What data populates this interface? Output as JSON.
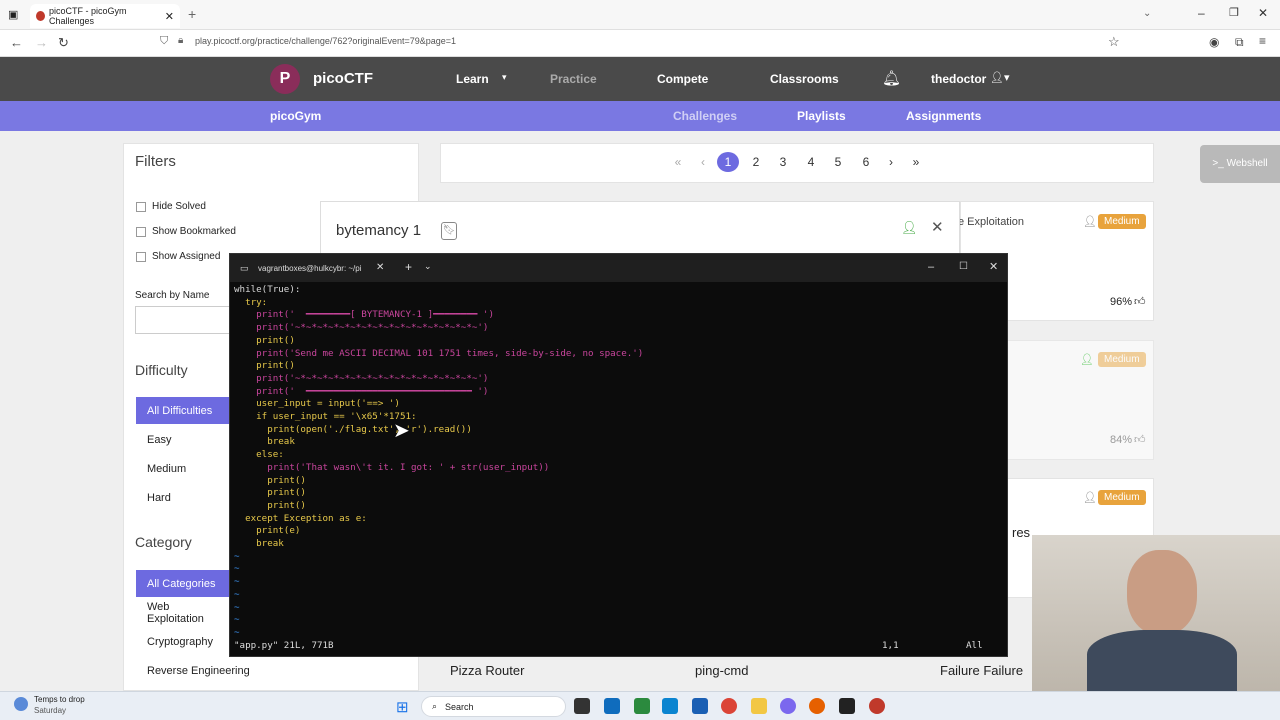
{
  "browser": {
    "tab_title": "picoCTF - picoGym Challenges",
    "url": "play.picoctf.org/practice/challenge/762?originalEvent=79&page=1"
  },
  "nav": {
    "brand": "picoCTF",
    "items": [
      "Learn",
      "Practice",
      "Compete",
      "Classrooms"
    ],
    "user": "thedoctor"
  },
  "subnav": {
    "brand": "picoGym",
    "items": [
      "Challenges",
      "Playlists",
      "Assignments"
    ]
  },
  "webshell_label": ">_ Webshell",
  "filters": {
    "title": "Filters",
    "checks": [
      "Hide Solved",
      "Show Bookmarked",
      "Show Assigned"
    ],
    "search_label": "Search by Name",
    "difficulty_title": "Difficulty",
    "difficulty": [
      "All Difficulties",
      "Easy",
      "Medium",
      "Hard"
    ],
    "category_title": "Category",
    "category": [
      "All Categories",
      "Web Exploitation",
      "Cryptography",
      "Reverse Engineering"
    ]
  },
  "pagination": {
    "first": "«",
    "prev": "‹",
    "pages": [
      "1",
      "2",
      "3",
      "4",
      "5",
      "6"
    ],
    "next": "›",
    "last": "»"
  },
  "modal": {
    "title": "bytemancy 1"
  },
  "cards": {
    "right_text": "e Exploitation",
    "badge1": "Medium",
    "pct1": "96%",
    "badge2": "Medium",
    "pct2": "84%",
    "badge3": "Medium",
    "res_text": "res",
    "bottom": [
      "Pizza Router",
      "ping-cmd",
      "Failure Failure"
    ]
  },
  "terminal": {
    "title": "vagrantboxes@hulkcybr: ~/pi",
    "code": [
      {
        "t": "while(True):",
        "c": ""
      },
      {
        "t": "  try:",
        "c": "k"
      },
      {
        "t": "    print('  ━━━━━━━━[ BYTEMANCY-1 ]━━━━━━━━ ')",
        "c": "s"
      },
      {
        "t": "    print('~*~*~*~*~*~*~*~*~*~*~*~*~*~*~*~*~')",
        "c": "s"
      },
      {
        "t": "    print()",
        "c": "k"
      },
      {
        "t": "    print('Send me ASCII DECIMAL 101 1751 times, side-by-side, no space.')",
        "c": "s"
      },
      {
        "t": "    print()",
        "c": "k"
      },
      {
        "t": "    print('~*~*~*~*~*~*~*~*~*~*~*~*~*~*~*~*~')",
        "c": "s"
      },
      {
        "t": "    print('  ━━━━━━━━━━━━━━━━━━━━━━━━━━━━━━ ')",
        "c": "s"
      },
      {
        "t": "    user_input = input('==> ')",
        "c": "k"
      },
      {
        "t": "    if user_input == '\\x65'*1751:",
        "c": "k"
      },
      {
        "t": "      print(open('./flag.txt', 'r').read())",
        "c": "k"
      },
      {
        "t": "      break",
        "c": "k"
      },
      {
        "t": "    else:",
        "c": "k"
      },
      {
        "t": "      print('That wasn\\'t it. I got: ' + str(user_input))",
        "c": "s"
      },
      {
        "t": "      print()",
        "c": "k"
      },
      {
        "t": "      print()",
        "c": "k"
      },
      {
        "t": "      print()",
        "c": "k"
      },
      {
        "t": "  except Exception as e:",
        "c": "k"
      },
      {
        "t": "    print(e)",
        "c": "k"
      },
      {
        "t": "    break",
        "c": "k"
      },
      {
        "t": "~",
        "c": "g"
      },
      {
        "t": "~",
        "c": "g"
      },
      {
        "t": "~",
        "c": "g"
      },
      {
        "t": "~",
        "c": "g"
      },
      {
        "t": "~",
        "c": "g"
      },
      {
        "t": "~",
        "c": "g"
      },
      {
        "t": "~",
        "c": "g"
      }
    ],
    "status_file": "\"app.py\" 21L, 771B",
    "status_pos": "1,1",
    "status_all": "All"
  },
  "taskbar": {
    "weather": "Temps to drop",
    "weather_sub": "Saturday",
    "search": "Search"
  }
}
